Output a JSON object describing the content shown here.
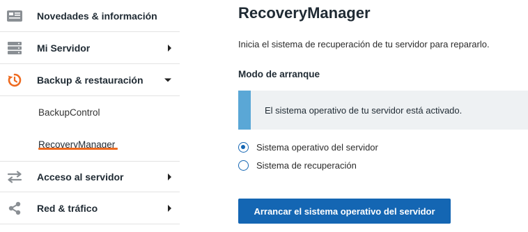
{
  "sidebar": {
    "items": [
      {
        "label": "Novedades & información",
        "icon": "news-icon"
      },
      {
        "label": "Mi Servidor",
        "icon": "server-icon"
      },
      {
        "label": "Backup & restauración",
        "icon": "restore-icon"
      },
      {
        "label": "Acceso al servidor",
        "icon": "transfer-arrows-icon"
      },
      {
        "label": "Red & tráfico",
        "icon": "share-network-icon"
      }
    ],
    "subitems": [
      {
        "label": "BackupControl"
      },
      {
        "label": "RecoveryManager",
        "active": true
      }
    ]
  },
  "main": {
    "title": "RecoveryManager",
    "intro": "Inicia el sistema de recuperación de tu servidor para repararlo.",
    "boot_mode_label": "Modo de arranque",
    "info_message": "El sistema operativo de tu servidor está activado.",
    "options": [
      {
        "label": "Sistema operativo del servidor",
        "selected": true
      },
      {
        "label": "Sistema de recuperación",
        "selected": false
      }
    ],
    "primary_button": "Arrancar el sistema operativo del servidor"
  },
  "colors": {
    "accent": "#1466b3",
    "active_underline": "#ee6a1f",
    "restore_icon": "#ee6a1f",
    "info_bar": "#5aa7d6",
    "info_bg": "#eef1f3"
  }
}
